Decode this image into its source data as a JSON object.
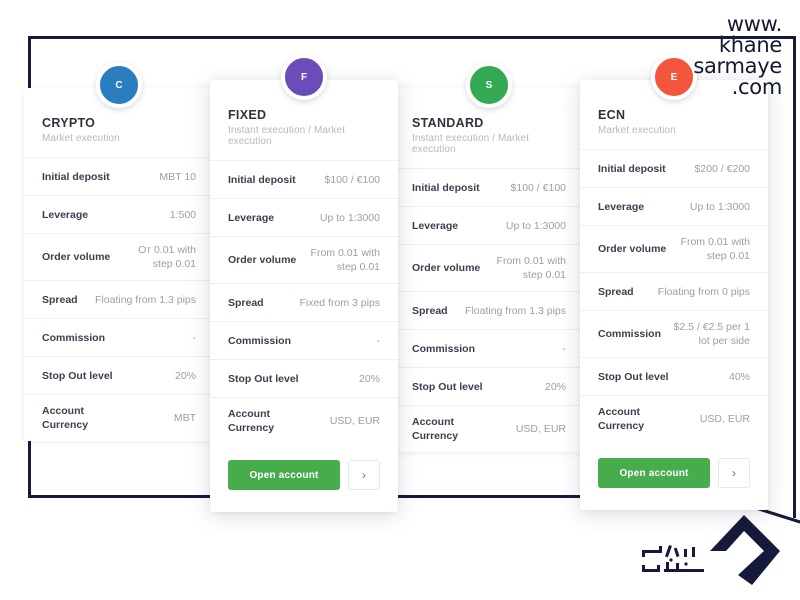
{
  "watermark": {
    "lines": [
      "www.",
      "khane",
      "sarmaye",
      ".com"
    ],
    "color": "#15192f"
  },
  "logo": {
    "name": "khane-sarmaye-house-logo",
    "color": "#161a3a"
  },
  "frame": {
    "color": "#161a3a"
  },
  "common": {
    "open_account_label": "Open account",
    "arrow_label": "›",
    "row_labels": {
      "initial_deposit": "Initial deposit",
      "leverage": "Leverage",
      "order_volume": "Order volume",
      "spread": "Spread",
      "commission": "Commission",
      "stop_out_level": "Stop Out level",
      "account_currency": "Account Currency"
    }
  },
  "cards": [
    {
      "id": "crypto",
      "badge_letter": "C",
      "badge_color": "#2a7ec0",
      "title": "CRYPTO",
      "subtitle": "Market execution",
      "has_cta": false,
      "rows": [
        {
          "label": "Initial deposit",
          "value": "MBT 10"
        },
        {
          "label": "Leverage",
          "value": "1:500"
        },
        {
          "label": "Order volume",
          "value": "Oт 0.01 with step 0.01"
        },
        {
          "label": "Spread",
          "value": "Floating from 1.3 pips"
        },
        {
          "label": "Commission",
          "value": "-"
        },
        {
          "label": "Stop Out level",
          "value": "20%"
        },
        {
          "label": "Account Currency",
          "value": "MBT"
        }
      ]
    },
    {
      "id": "fixed",
      "badge_letter": "F",
      "badge_color": "#6b4cb8",
      "title": "FIXED",
      "subtitle": "Instant execution / Market execution",
      "has_cta": true,
      "rows": [
        {
          "label": "Initial deposit",
          "value": "$100 / €100"
        },
        {
          "label": "Leverage",
          "value": "Up to 1:3000"
        },
        {
          "label": "Order volume",
          "value": "From 0.01 with step 0.01"
        },
        {
          "label": "Spread",
          "value": "Fixed from 3 pips"
        },
        {
          "label": "Commission",
          "value": "-"
        },
        {
          "label": "Stop Out level",
          "value": "20%"
        },
        {
          "label": "Account Currency",
          "value": "USD, EUR"
        }
      ]
    },
    {
      "id": "standard",
      "badge_letter": "S",
      "badge_color": "#34a853",
      "title": "STANDARD",
      "subtitle": "Instant execution / Market execution",
      "has_cta": false,
      "rows": [
        {
          "label": "Initial deposit",
          "value": "$100 / €100"
        },
        {
          "label": "Leverage",
          "value": "Up to 1:3000"
        },
        {
          "label": "Order volume",
          "value": "From 0.01 with step 0.01"
        },
        {
          "label": "Spread",
          "value": "Floating from 1.3 pips"
        },
        {
          "label": "Commission",
          "value": "-"
        },
        {
          "label": "Stop Out level",
          "value": "20%"
        },
        {
          "label": "Account Currency",
          "value": "USD, EUR"
        }
      ]
    },
    {
      "id": "ecn",
      "badge_letter": "E",
      "badge_color": "#f4553d",
      "title": "ECN",
      "subtitle": "Market execution",
      "has_cta": true,
      "rows": [
        {
          "label": "Initial deposit",
          "value": "$200 / €200"
        },
        {
          "label": "Leverage",
          "value": "Up to 1:3000"
        },
        {
          "label": "Order volume",
          "value": "From 0.01 with step 0.01"
        },
        {
          "label": "Spread",
          "value": "Floating from 0 pips"
        },
        {
          "label": "Commission",
          "value": "$2.5 / €2.5 per 1 lot per side"
        },
        {
          "label": "Stop Out level",
          "value": "40%"
        },
        {
          "label": "Account Currency",
          "value": "USD, EUR"
        }
      ]
    }
  ]
}
